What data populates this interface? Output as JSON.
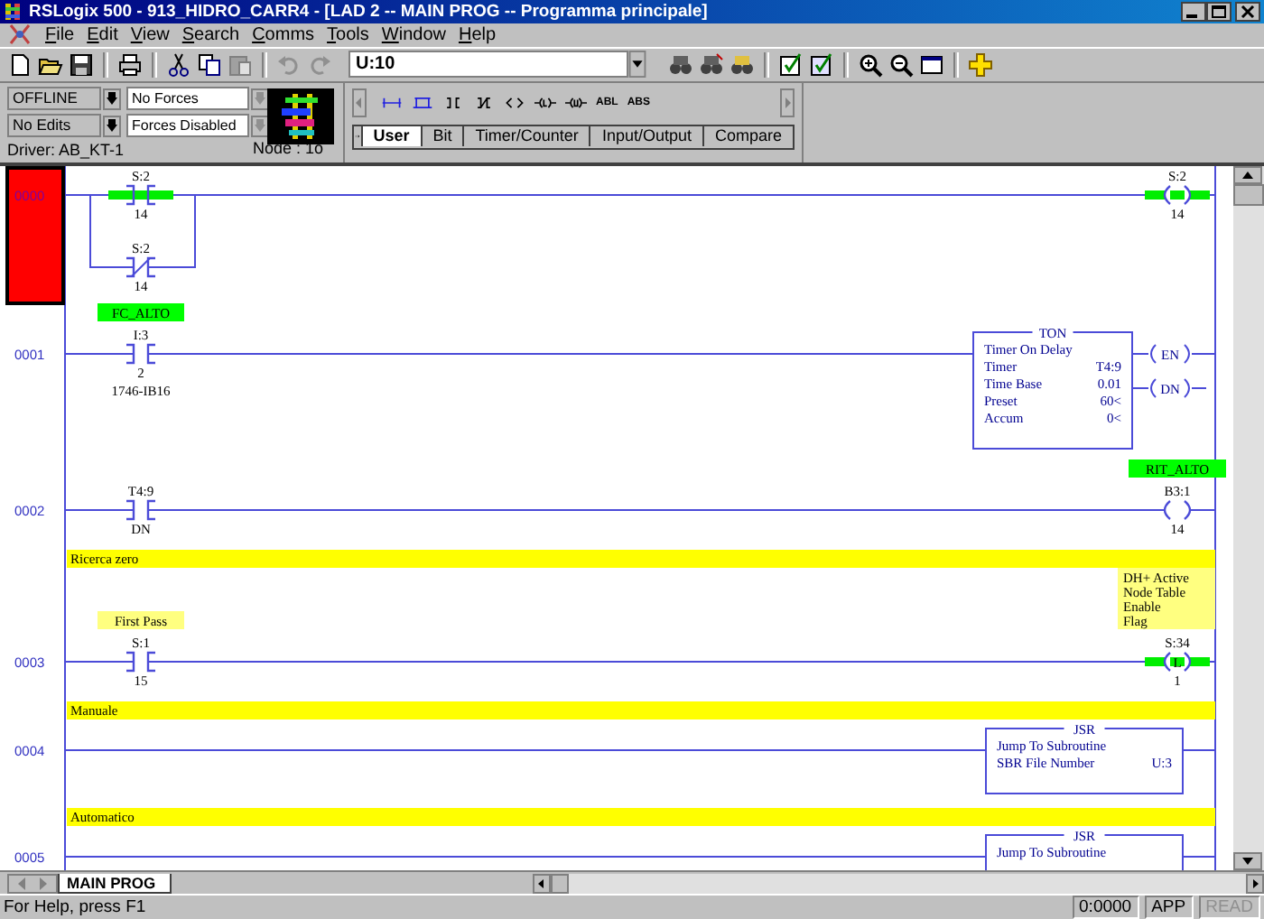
{
  "window": {
    "title": "RSLogix 500 - 913_HIDRO_CARR4 - [LAD 2 -- MAIN PROG -- Programma principale]"
  },
  "menu": [
    "File",
    "Edit",
    "View",
    "Search",
    "Comms",
    "Tools",
    "Window",
    "Help"
  ],
  "toolbar": {
    "address": "U:10"
  },
  "processor": {
    "mode": "OFFLINE",
    "edits": "No Edits",
    "forces": "No Forces",
    "forces_status": "Forces Disabled",
    "driver": "Driver: AB_KT-1",
    "node": "Node : 1o"
  },
  "palette": {
    "text_buttons": [
      "ABL",
      "ABS"
    ],
    "tabs": [
      {
        "label": "User",
        "selected": true
      },
      {
        "label": "Bit",
        "selected": false
      },
      {
        "label": "Timer/Counter",
        "selected": false
      },
      {
        "label": "Input/Output",
        "selected": false
      },
      {
        "label": "Compare",
        "selected": false
      }
    ]
  },
  "rungs": [
    {
      "number": "0000",
      "selected": true,
      "legs": [
        [
          {
            "kind": "xic",
            "address": "S:2",
            "bit": "14",
            "energized": true
          }
        ],
        [
          {
            "kind": "xio",
            "address": "S:2",
            "bit": "14",
            "energized": false
          }
        ]
      ],
      "outputs": [
        {
          "kind": "ote",
          "address": "S:2",
          "bit": "14",
          "energized": true
        }
      ]
    },
    {
      "number": "0001",
      "selected": false,
      "legs": [
        [
          {
            "kind": "xic",
            "label": {
              "lines": [
                "FC_ALTO"
              ],
              "color": "#00ff00"
            },
            "address": "I:3",
            "bit": "2",
            "module": "1746-IB16",
            "energized": false
          }
        ]
      ],
      "outputs": [
        {
          "kind": "ton",
          "title": "TON",
          "description": "Timer On Delay",
          "params": [
            {
              "name": "Timer",
              "value": "T4:9"
            },
            {
              "name": "Time Base",
              "value": "0.01"
            },
            {
              "name": "Preset",
              "value": "60<"
            },
            {
              "name": "Accum",
              "value": "0<"
            }
          ],
          "flags": [
            "EN",
            "DN"
          ]
        }
      ]
    },
    {
      "number": "0002",
      "selected": false,
      "legs": [
        [
          {
            "kind": "xic",
            "address": "T4:9",
            "bit": "DN",
            "energized": false
          }
        ]
      ],
      "outputs": [
        {
          "kind": "ote",
          "label": {
            "lines": [
              "RIT_ALTO"
            ],
            "color": "#00ff00"
          },
          "address": "B3:1",
          "bit": "14",
          "energized": false
        }
      ]
    },
    {
      "number": "0003",
      "selected": false,
      "comment": "Ricerca zero",
      "legs": [
        [
          {
            "kind": "xic",
            "label": {
              "lines": [
                "First Pass"
              ],
              "color": "#ffff80"
            },
            "address": "S:1",
            "bit": "15",
            "energized": false
          }
        ]
      ],
      "outputs": [
        {
          "kind": "otl",
          "letter": "L",
          "label": {
            "lines": [
              "DH+ Active",
              "Node Table",
              "Enable",
              "Flag"
            ],
            "color": "#ffff80"
          },
          "address": "S:34",
          "bit": "1",
          "energized": true
        }
      ]
    },
    {
      "number": "0004",
      "selected": false,
      "comment": "Manuale",
      "outputs": [
        {
          "kind": "jsr",
          "title": "JSR",
          "description": "Jump To Subroutine",
          "params": [
            {
              "name": "SBR File Number",
              "value": "U:3"
            }
          ]
        }
      ]
    },
    {
      "number": "0005",
      "selected": false,
      "comment": "Automatico",
      "outputs": [
        {
          "kind": "jsr",
          "title": "JSR",
          "description": "Jump To Subroutine"
        }
      ]
    }
  ],
  "sheet_tabs": [
    {
      "label": "MAIN PROG",
      "selected": true
    }
  ],
  "status_bar": {
    "help": "For Help, press F1",
    "fields": [
      {
        "text": "0:0000",
        "disabled": false
      },
      {
        "text": "APP",
        "disabled": false
      },
      {
        "text": "READ",
        "disabled": true
      }
    ]
  }
}
